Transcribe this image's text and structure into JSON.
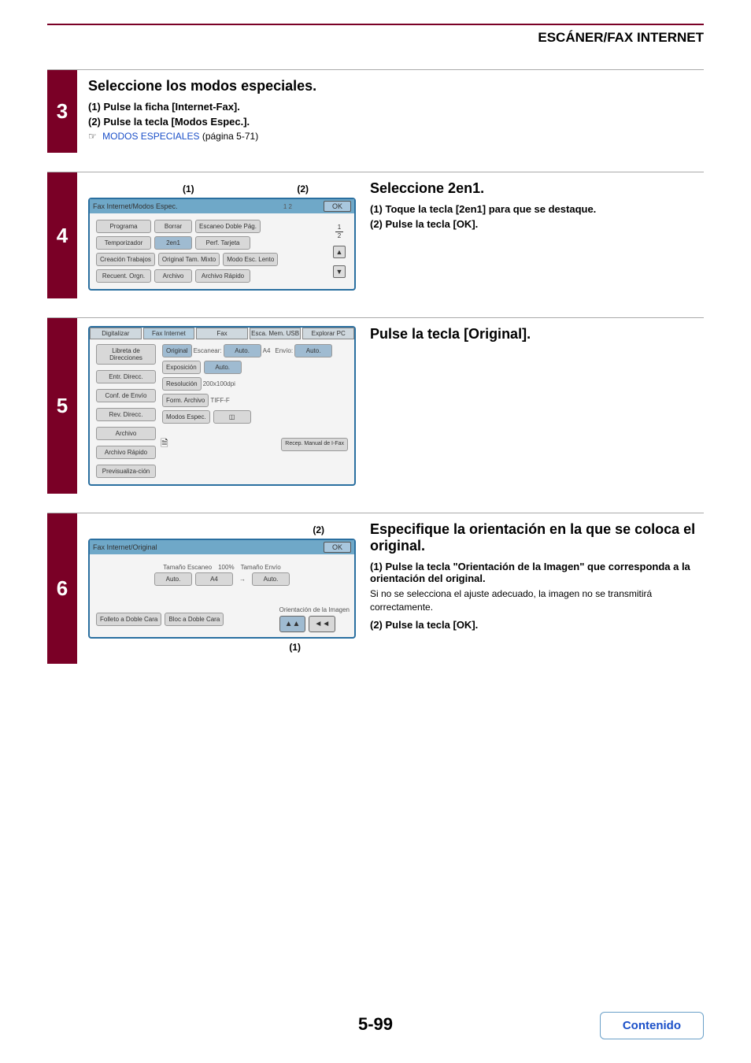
{
  "header": {
    "title": "ESCÁNER/FAX INTERNET"
  },
  "step3": {
    "number": "3",
    "heading": "Seleccione los modos especiales.",
    "sub1": "(1)  Pulse la ficha [Internet-Fax].",
    "sub2": "(2)  Pulse la tecla [Modos Espec.].",
    "link_icon": "☞",
    "link_text": "MODOS ESPECIALES",
    "link_trail": " (página 5-71)"
  },
  "step4": {
    "number": "4",
    "annot1": "(1)",
    "annot2": "(2)",
    "panel": {
      "title": "Fax Internet/Modos Espec.",
      "icon12": "1 2",
      "ok": "OK",
      "btn_programa": "Programa",
      "btn_borrar": "Borrar",
      "btn_escaneo": "Escaneo Doble Pág.",
      "btn_temporizador": "Temporizador",
      "btn_2en1": "2en1",
      "btn_perf": "Perf. Tarjeta",
      "btn_creacion": "Creación Trabajos",
      "btn_original": "Original Tam. Mixto",
      "btn_modo": "Modo Esc. Lento",
      "btn_recuent": "Recuent. Orgn.",
      "btn_archivo": "Archivo",
      "btn_rapido": "Archivo Rápido",
      "frac_top": "1",
      "frac_bot": "2"
    },
    "right": {
      "heading": "Seleccione 2en1.",
      "sub1": "(1)  Toque la tecla [2en1] para que se destaque.",
      "sub2": "(2)  Pulse la tecla [OK]."
    }
  },
  "step5": {
    "number": "5",
    "panel": {
      "tab_digitalizar": "Digitalizar",
      "tab_fax_internet": "Fax Internet",
      "tab_fax": "Fax",
      "tab_esca": "Esca. Mem. USB",
      "tab_explorar": "Explorar PC",
      "side_libreta": "Libreta de Direcciones",
      "side_entr": "Entr. Direcc.",
      "side_conf": "Conf. de Envío",
      "side_rev": "Rev. Direcc.",
      "side_archivo": "Archivo",
      "side_rapido": "Archivo Rápido",
      "side_prev": "Previsualiza-ción",
      "btn_original": "Original",
      "lbl_escanear": "Escanear:",
      "val_auto1": "Auto.",
      "val_a4": "A4",
      "lbl_envio": "Envío:",
      "val_auto2": "Auto.",
      "btn_exp": "Exposición",
      "val_auto3": "Auto.",
      "btn_res": "Resolución",
      "val_res": "200x100dpi",
      "btn_form": "Form. Archivo",
      "val_form": "TIFF-F",
      "btn_modos": "Modos Espec.",
      "icon_modos": "◫",
      "btn_recep": "Recep. Manual de I-Fax"
    },
    "right": {
      "heading": "Pulse la tecla [Original]."
    }
  },
  "step6": {
    "number": "6",
    "annot2": "(2)",
    "annot1": "(1)",
    "panel": {
      "title": "Fax Internet/Original",
      "ok": "OK",
      "lbl_tam_escaneo": "Tamaño Escaneo",
      "lbl_pct": "100%",
      "lbl_tam_envio": "Tamaño Envío",
      "btn_auto": "Auto.",
      "btn_a4": "A4",
      "arrow": "→",
      "btn_auto2": "Auto.",
      "btn_folleto": "Folleto a Doble Cara",
      "btn_bloc": "Bloc a Doble Cara",
      "lbl_orient": "Orientación de la Imagen",
      "orient1": "▲▲",
      "orient2": "◄◄"
    },
    "right": {
      "heading": "Especifique la orientación en la que se coloca el original.",
      "sub1": "(1)  Pulse la tecla \"Orientación de la Imagen\" que corresponda a la orientación del original.",
      "body1": "Si no se selecciona el ajuste adecuado, la imagen no se transmitirá correctamente.",
      "sub2": "(2)  Pulse la tecla [OK]."
    }
  },
  "footer": {
    "page": "5-99",
    "contenido": "Contenido"
  }
}
